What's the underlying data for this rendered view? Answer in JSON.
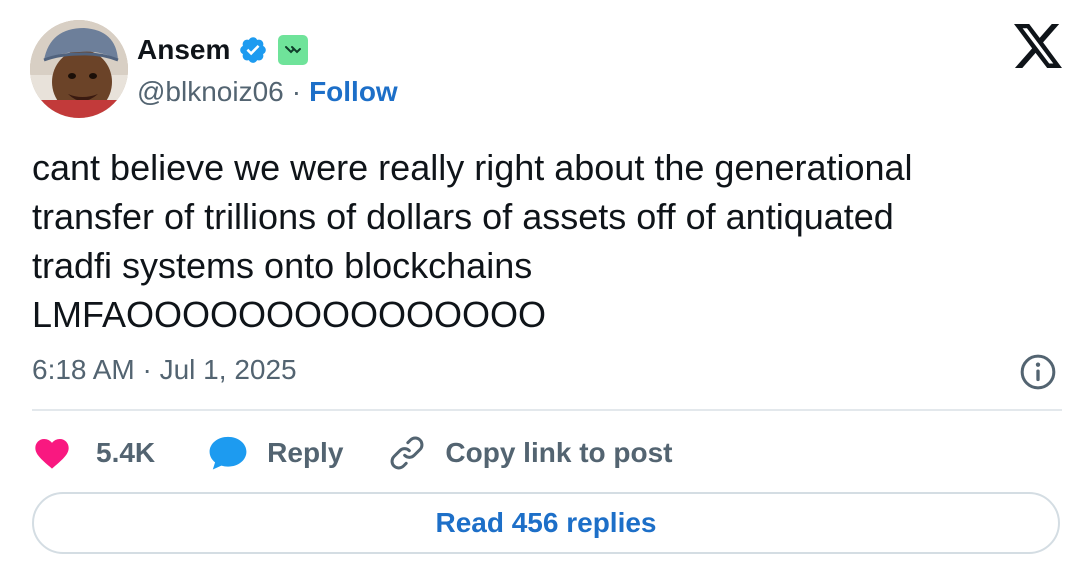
{
  "author": {
    "name": "Ansem",
    "handle": "@blknoiz06",
    "separator": "·",
    "follow_label": "Follow"
  },
  "tweet": {
    "text": "cant believe we were really right about the generational\ntransfer of trillions of dollars of assets off of antiquated\ntradfi systems onto blockchains\nLMFAOOOOOOOOOOOOOOO",
    "timestamp": "6:18 AM · Jul 1, 2025"
  },
  "actions": {
    "likes": "5.4K",
    "reply_label": "Reply",
    "copy_label": "Copy link to post"
  },
  "read_replies_label": "Read 456 replies",
  "colors": {
    "accent": "#1d6fc8",
    "heart": "#f91880",
    "reply_icon": "#1d9bf0",
    "verified": "#1d9bf0",
    "affiliate_badge": "#6fe39a",
    "secondary_text": "#536471"
  },
  "icons": {
    "verified": "verified-badge-icon",
    "affiliate": "affiliate-badge-icon",
    "brand": "x-logo-icon",
    "info": "info-icon",
    "like": "heart-icon",
    "reply": "reply-bubble-icon",
    "copy": "link-icon"
  }
}
